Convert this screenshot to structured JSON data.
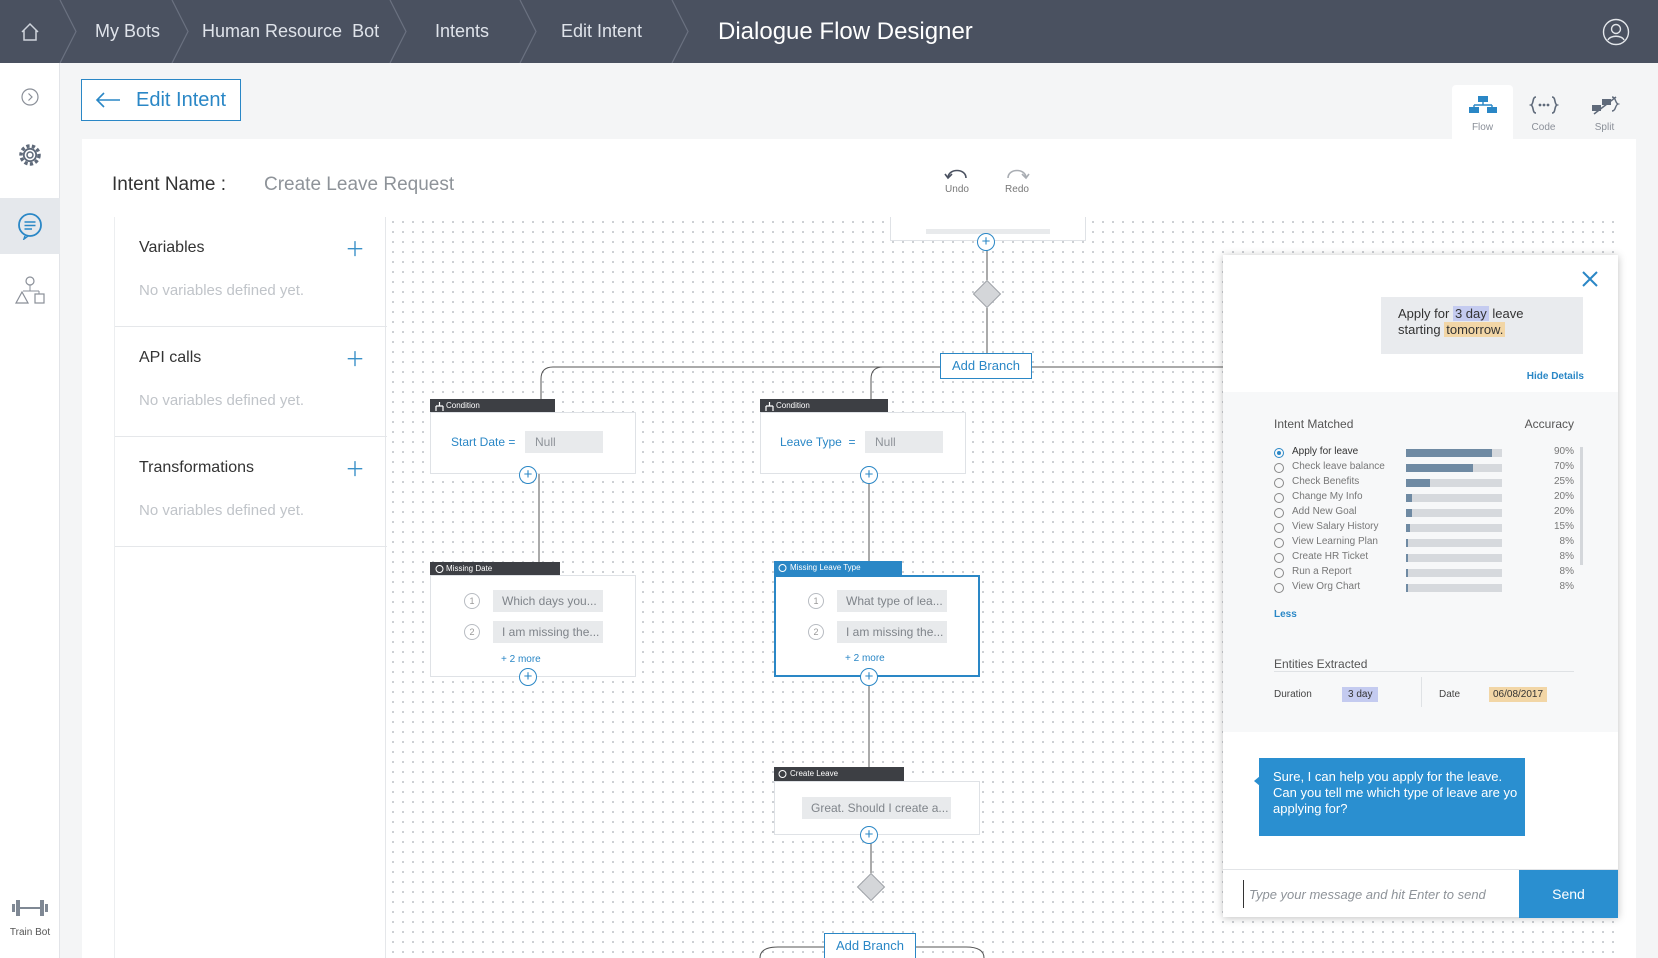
{
  "nav": {
    "breadcrumbs": [
      "My Bots",
      "Human Resource  Bot",
      "Intents",
      "Edit Intent"
    ],
    "title": "Dialogue Flow Designer"
  },
  "rail": {
    "train_label": "Train Bot"
  },
  "edit_button": {
    "label": "Edit Intent"
  },
  "view_tabs": [
    {
      "label": "Flow",
      "icon": "flow-icon",
      "active": true
    },
    {
      "label": "Code",
      "icon": "code-icon",
      "active": false
    },
    {
      "label": "Split",
      "icon": "split-icon",
      "active": false
    }
  ],
  "intent": {
    "label": "Intent Name :",
    "value": "Create Leave Request"
  },
  "toolbar": {
    "undo": "Undo",
    "redo": "Redo"
  },
  "data_panel": {
    "sections": [
      {
        "title": "Variables",
        "empty": "No variables defined yet."
      },
      {
        "title": "API calls",
        "empty": "No variables defined yet."
      },
      {
        "title": "Transformations",
        "empty": "No variables defined yet."
      }
    ]
  },
  "flow": {
    "add_branch": "Add Branch",
    "condition_tab": "Condition",
    "null": "Null",
    "cond1_label": "Start Date =",
    "cond2_label": "Leave Type  =",
    "missing_date": {
      "tab": "Missing Date",
      "p1": "Which days you...",
      "p2": "I am missing the...",
      "more": "+ 2 more"
    },
    "missing_type": {
      "tab": "Missing Leave Type",
      "p1": "What type of lea...",
      "p2": "I am missing the...",
      "more": "+ 2 more"
    },
    "create_leave": {
      "tab": "Create Leave",
      "p1": "Great. Should I create a..."
    },
    "n1": "1",
    "n2": "2"
  },
  "chat": {
    "user_msg_parts": [
      "Apply for",
      "3 day",
      "leave",
      "starting",
      "tomorrow."
    ],
    "hide_details": "Hide Details",
    "intent_matched": "Intent Matched",
    "accuracy": "Accuracy",
    "intents": [
      {
        "name": "Apply for leave",
        "pct": "90%",
        "value": 0.9,
        "selected": true
      },
      {
        "name": "Check leave balance",
        "pct": "70%",
        "value": 0.7,
        "selected": false
      },
      {
        "name": "Check Benefits",
        "pct": "25%",
        "value": 0.25,
        "selected": false
      },
      {
        "name": "Change My Info",
        "pct": "20%",
        "value": 0.06,
        "selected": false
      },
      {
        "name": "Add New Goal",
        "pct": "20%",
        "value": 0.06,
        "selected": false
      },
      {
        "name": "View Salary History",
        "pct": "15%",
        "value": 0.04,
        "selected": false
      },
      {
        "name": "View Learning Plan",
        "pct": "8%",
        "value": 0.02,
        "selected": false
      },
      {
        "name": "Create HR Ticket",
        "pct": "8%",
        "value": 0.02,
        "selected": false
      },
      {
        "name": "Run a Report",
        "pct": "8%",
        "value": 0.02,
        "selected": false
      },
      {
        "name": "View Org Chart",
        "pct": "8%",
        "value": 0.02,
        "selected": false
      }
    ],
    "less": "Less",
    "entities_title": "Entities Extracted",
    "entities": {
      "duration_label": "Duration",
      "duration_value": "3 day",
      "date_label": "Date",
      "date_value": "06/08/2017"
    },
    "bot_lines": [
      "Sure, I can help you apply for the leave.",
      "Can you tell me which type of leave are yo",
      "applying for?"
    ],
    "input_placeholder": "Type your message and hit Enter to send",
    "send": "Send"
  },
  "colors": {
    "accent": "#2a87c6",
    "nav_bg": "#4a5160",
    "highlight_duration": "#c4cbf0",
    "highlight_date": "#f2d6a6"
  }
}
